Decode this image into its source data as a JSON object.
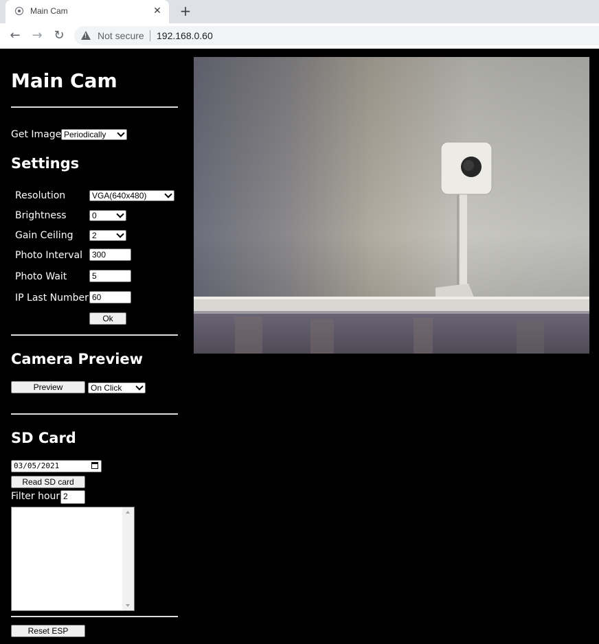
{
  "browser": {
    "tab_title": "Main Cam",
    "security_label": "Not secure",
    "url": "192.168.0.60"
  },
  "page": {
    "title": "Main Cam",
    "get_image": {
      "label": "Get Image:",
      "selected": "Periodically"
    },
    "settings": {
      "heading": "Settings",
      "resolution": {
        "label": "Resolution",
        "value": "VGA(640x480)"
      },
      "brightness": {
        "label": "Brightness",
        "value": "0"
      },
      "gain_ceiling": {
        "label": "Gain Ceiling",
        "value": "2"
      },
      "photo_interval": {
        "label": "Photo Interval",
        "value": "300"
      },
      "photo_wait": {
        "label": "Photo Wait",
        "value": "5"
      },
      "ip_last_number": {
        "label": "IP Last Number",
        "value": "60"
      },
      "ok_label": "Ok"
    },
    "camera_preview": {
      "heading": "Camera Preview",
      "preview_label": "Preview",
      "mode_selected": "On Click"
    },
    "sd_card": {
      "heading": "SD Card",
      "date_value": "03/05/2021",
      "read_label": "Read SD card",
      "filter_label": "Filter hour:",
      "filter_value": "2",
      "list_content": ""
    },
    "reset_label": "Reset ESP"
  }
}
